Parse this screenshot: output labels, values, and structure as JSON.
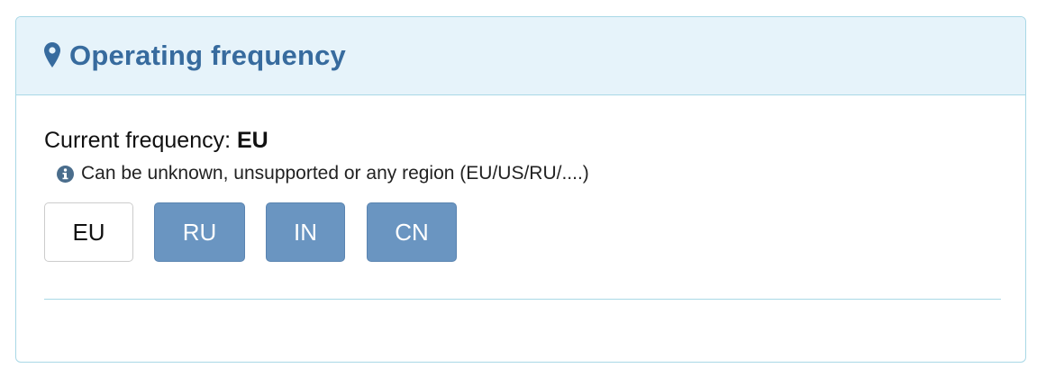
{
  "panel": {
    "title": "Operating frequency",
    "title_icon": "map-marker-icon",
    "current_label": "Current frequency: ",
    "current_value": "EU",
    "hint_icon": "info-circle-icon",
    "hint_text": "Can be unknown, unsupported or any region (EU/US/RU/....)",
    "buttons": [
      {
        "label": "EU",
        "state": "current"
      },
      {
        "label": "RU",
        "state": "option"
      },
      {
        "label": "IN",
        "state": "option"
      },
      {
        "label": "CN",
        "state": "option"
      }
    ]
  },
  "colors": {
    "heading_bg": "#e6f3fa",
    "heading_text": "#376b9e",
    "border": "#a9d8e6",
    "option_button": "#6a95c1"
  }
}
